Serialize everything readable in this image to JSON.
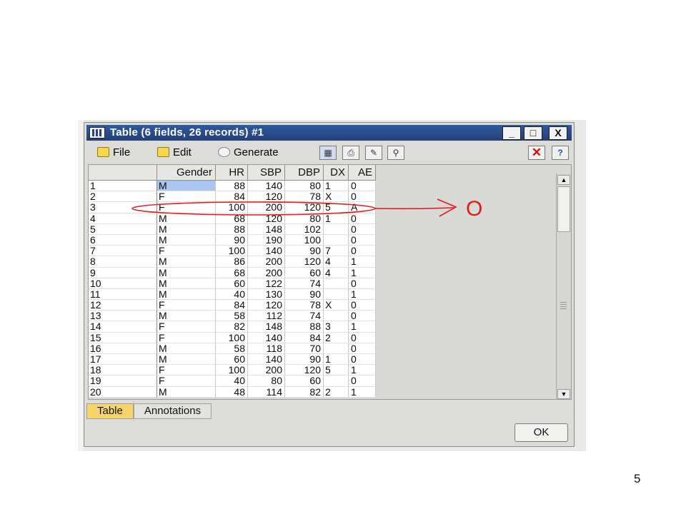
{
  "window": {
    "title": "Table (6 fields, 26 records) #1",
    "buttons": {
      "minimize": "_",
      "maximize": "□",
      "close": "X"
    }
  },
  "menu": {
    "file": "File",
    "edit": "Edit",
    "generate": "Generate"
  },
  "toolbar_icons": [
    "table-view-icon",
    "print-icon",
    "export-icon",
    "find-icon",
    "close-icon",
    "help-icon"
  ],
  "table": {
    "columns": [
      "Gender",
      "HR",
      "SBP",
      "DBP",
      "DX",
      "AE"
    ],
    "rows": [
      [
        "1",
        "M",
        "88",
        "140",
        "80",
        "1",
        "0"
      ],
      [
        "2",
        "F",
        "84",
        "120",
        "78",
        "X",
        "0"
      ],
      [
        "3",
        "F",
        "100",
        "200",
        "120",
        "5",
        "A"
      ],
      [
        "4",
        "M",
        "68",
        "120",
        "80",
        "1",
        "0"
      ],
      [
        "5",
        "M",
        "88",
        "148",
        "102",
        "",
        "0"
      ],
      [
        "6",
        "M",
        "90",
        "190",
        "100",
        "",
        "0"
      ],
      [
        "7",
        "F",
        "100",
        "140",
        "90",
        "7",
        "0"
      ],
      [
        "8",
        "M",
        "86",
        "200",
        "120",
        "4",
        "1"
      ],
      [
        "9",
        "M",
        "68",
        "200",
        "60",
        "4",
        "1"
      ],
      [
        "10",
        "M",
        "60",
        "122",
        "74",
        "",
        "0"
      ],
      [
        "11",
        "M",
        "40",
        "130",
        "90",
        "",
        "1"
      ],
      [
        "12",
        "F",
        "84",
        "120",
        "78",
        "X",
        "0"
      ],
      [
        "13",
        "M",
        "58",
        "112",
        "74",
        "",
        "0"
      ],
      [
        "14",
        "F",
        "82",
        "148",
        "88",
        "3",
        "1"
      ],
      [
        "15",
        "F",
        "100",
        "140",
        "84",
        "2",
        "0"
      ],
      [
        "16",
        "M",
        "58",
        "118",
        "70",
        "",
        "0"
      ],
      [
        "17",
        "M",
        "60",
        "140",
        "90",
        "1",
        "0"
      ],
      [
        "18",
        "F",
        "100",
        "200",
        "120",
        "5",
        "1"
      ],
      [
        "19",
        "F",
        "40",
        "80",
        "60",
        "",
        "0"
      ],
      [
        "20",
        "M",
        "48",
        "114",
        "82",
        "2",
        "1"
      ]
    ]
  },
  "tabs": [
    "Table",
    "Annotations"
  ],
  "ok_label": "OK",
  "annotation": {
    "handwritten": "O",
    "color": "#e11a1a"
  },
  "page_number": "5",
  "colors": {
    "titlebar": "#2e5aa0",
    "active_tab": "#f6d56a",
    "selection": "#a9c7ee"
  }
}
